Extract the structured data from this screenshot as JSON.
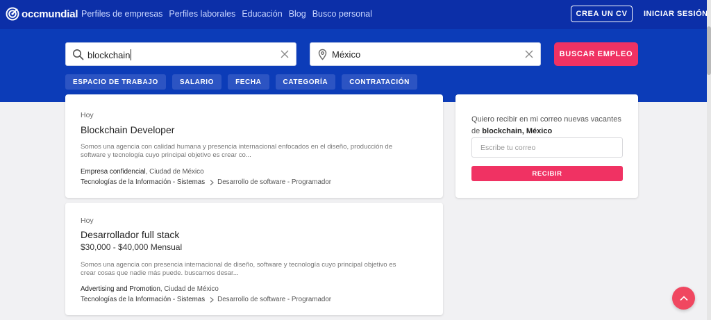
{
  "brand": {
    "name": "occmundial",
    "color": "#0c2fa8",
    "accent": "#f03263"
  },
  "nav": {
    "links": [
      "Perfiles de empresas",
      "Perfiles laborales",
      "Educación",
      "Blog",
      "Busco personal"
    ],
    "cv_button": "CREA UN CV",
    "login": "INICIAR SESIÓN"
  },
  "search": {
    "keyword": {
      "value": "blockchain",
      "icon": "search-icon",
      "clear_icon": "close-icon"
    },
    "location": {
      "value": "México",
      "icon": "location-pin-icon",
      "clear_icon": "close-icon"
    },
    "button": "BUSCAR EMPLEO"
  },
  "filters": [
    "ESPACIO DE TRABAJO",
    "SALARIO",
    "FECHA",
    "CATEGORÍA",
    "CONTRATACIÓN"
  ],
  "jobs": [
    {
      "date": "Hoy",
      "title": "Blockchain Developer",
      "salary": "",
      "description": "Somos una agencia con calidad humana y presencia internacional enfocados en el diseño, producción de software y tecnología cuyo principal objetivo es crear co...",
      "company": "Empresa confidencial",
      "location": ", Ciudad de México",
      "category": "Tecnologías de la Información - Sistemas",
      "subcategory": "Desarrollo de software - Programador"
    },
    {
      "date": "Hoy",
      "title": "Desarrollador full stack",
      "salary": "$30,000 - $40,000 Mensual",
      "description": "Somos una agencia con presencia internacional de diseño, software y tecnología cuyo principal objetivo es crear cosas que nadie más puede. buscamos desar...",
      "company": "Advertising and Promotion",
      "location": ", Ciudad de México",
      "category": "Tecnologías de la Información - Sistemas",
      "subcategory": "Desarrollo de software - Programador"
    }
  ],
  "alert": {
    "text_1": "Quiero recibir en mi correo nuevas vacantes de ",
    "keywords": "blockchain, México",
    "email_placeholder": "Escribe tu correo",
    "button": "RECIBIR"
  },
  "fab": {
    "icon": "chevron-up-icon"
  }
}
